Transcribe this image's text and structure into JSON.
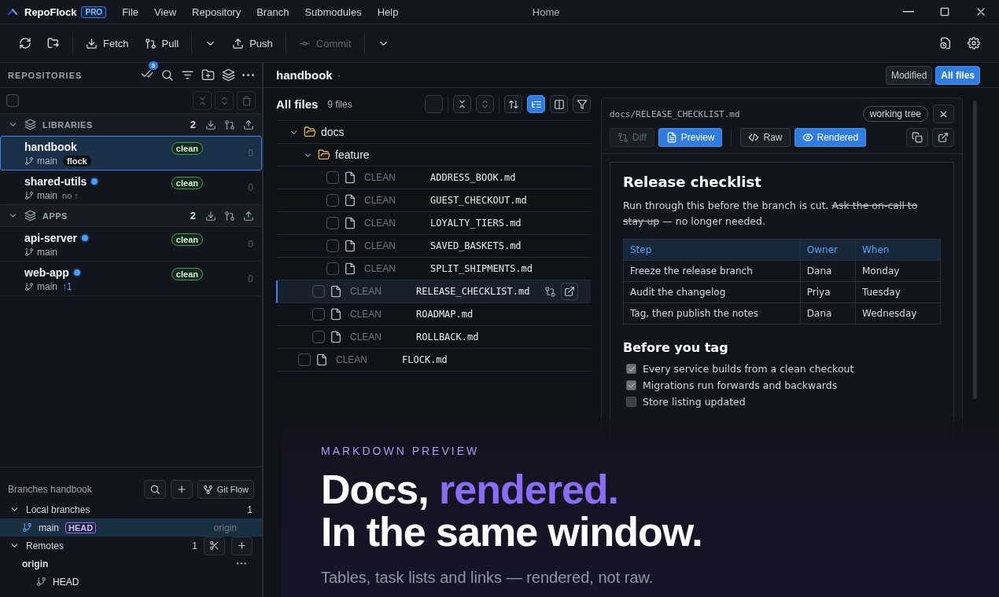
{
  "app": {
    "name": "RepoFlock",
    "badge": "PRO"
  },
  "menu": [
    "File",
    "View",
    "Repository",
    "Branch",
    "Submodules",
    "Help"
  ],
  "window": {
    "title": "Home"
  },
  "toolbar": {
    "fetch": "Fetch",
    "pull": "Pull",
    "push": "Push",
    "commit": {
      "label": "Commit",
      "disabled": true
    }
  },
  "repositories": {
    "title": "REPOSITORIES",
    "notification_count": "3",
    "select_all": {
      "checked": false
    },
    "groups": [
      {
        "name": "LIBRARIES",
        "count": "2",
        "expanded": true,
        "repos": [
          {
            "name": "handbook",
            "indicator": false,
            "branch": "main",
            "tag": "flock",
            "status": "clean",
            "changes": "0",
            "selected": true
          },
          {
            "name": "shared-utils",
            "indicator": true,
            "branch": "main",
            "sync": {
              "text": "no ↑",
              "ahead": false
            },
            "status": "clean",
            "changes": "0",
            "selected": false
          }
        ]
      },
      {
        "name": "APPS",
        "count": "2",
        "expanded": true,
        "repos": [
          {
            "name": "api-server",
            "indicator": true,
            "branch": "main",
            "status": "clean",
            "changes": "0",
            "selected": false
          },
          {
            "name": "web-app",
            "indicator": true,
            "branch": "main",
            "sync": {
              "text": "↑1",
              "ahead": true
            },
            "status": "clean",
            "changes": "0",
            "selected": false
          }
        ]
      }
    ]
  },
  "branches": {
    "title": "Branches handbook",
    "gitflow": "Git Flow",
    "local": {
      "label": "Local branches",
      "count": "1",
      "expanded": true,
      "items": [
        {
          "name": "main",
          "badge": "HEAD",
          "upstream": "origin",
          "selected": true
        }
      ]
    },
    "remotes": {
      "label": "Remotes",
      "count": "1",
      "expanded": true,
      "items": [
        {
          "name": "origin",
          "children": [
            {
              "name": "HEAD"
            }
          ]
        }
      ]
    }
  },
  "workspace": {
    "repo": "handbook",
    "separator": "·",
    "filters": [
      {
        "label": "Modified",
        "selected": false
      },
      {
        "label": "All files",
        "selected": true
      }
    ]
  },
  "files": {
    "title": "All files",
    "count": "9 files",
    "select_all": {
      "checked": false
    },
    "view_buttons": [
      {
        "selected": false
      },
      {
        "selected": true
      },
      {
        "selected": false
      },
      {
        "selected": false
      }
    ],
    "tree": [
      {
        "kind": "folder",
        "name": "docs",
        "expanded": true,
        "children": [
          {
            "kind": "folder",
            "name": "feature",
            "expanded": true,
            "children": [
              {
                "kind": "file",
                "status": "CLEAN",
                "name": "ADDRESS_BOOK.md",
                "checked": false,
                "selected": false
              },
              {
                "kind": "file",
                "status": "CLEAN",
                "name": "GUEST_CHECKOUT.md",
                "checked": false,
                "selected": false
              },
              {
                "kind": "file",
                "status": "CLEAN",
                "name": "LOYALTY_TIERS.md",
                "checked": false,
                "selected": false
              },
              {
                "kind": "file",
                "status": "CLEAN",
                "name": "SAVED_BASKETS.md",
                "checked": false,
                "selected": false
              },
              {
                "kind": "file",
                "status": "CLEAN",
                "name": "SPLIT_SHIPMENTS.md",
                "checked": false,
                "selected": false
              }
            ]
          },
          {
            "kind": "file",
            "status": "CLEAN",
            "name": "RELEASE_CHECKLIST.md",
            "checked": false,
            "selected": true
          },
          {
            "kind": "file",
            "status": "CLEAN",
            "name": "ROADMAP.md",
            "checked": false,
            "selected": false
          },
          {
            "kind": "file",
            "status": "CLEAN",
            "name": "ROLLBACK.md",
            "checked": false,
            "selected": false
          }
        ]
      },
      {
        "kind": "file",
        "status": "CLEAN",
        "name": "FLOCK.md",
        "checked": false,
        "selected": false
      }
    ]
  },
  "preview": {
    "path": "docs/RELEASE_CHECKLIST.md",
    "ref": "working tree",
    "modes": [
      {
        "label": "Diff",
        "selected": false,
        "disabled": true
      },
      {
        "label": "Preview",
        "selected": true,
        "disabled": false
      }
    ],
    "formats": [
      {
        "label": "Raw",
        "selected": false
      },
      {
        "label": "Rendered",
        "selected": true
      }
    ],
    "doc": {
      "title": "Release checklist",
      "intro": "Run through this before the branch is cut.",
      "struck": "Ask the on-call to stay up",
      "intro_end": "— no longer needed.",
      "table": {
        "columns": [
          "Step",
          "Owner",
          "When"
        ],
        "rows": [
          [
            "Freeze the release branch",
            "Dana",
            "Monday"
          ],
          [
            "Audit the changelog",
            "Priya",
            "Tuesday"
          ],
          [
            "Tag, then publish the notes",
            "Dana",
            "Wednesday"
          ]
        ]
      },
      "section": "Before you tag",
      "tasks": [
        {
          "label": "Every service builds from a clean checkout",
          "checked": true
        },
        {
          "label": "Migrations run forwards and backwards",
          "checked": true
        },
        {
          "label": "Store listing updated",
          "checked": false
        }
      ]
    }
  },
  "promo": {
    "eyebrow": "MARKDOWN PREVIEW",
    "headline": [
      {
        "text": "Docs, ",
        "accent": false
      },
      {
        "text": "rendered.",
        "accent": true
      }
    ],
    "headline_2": "In the same window.",
    "subtitle": "Tables, task lists and links — rendered, not raw."
  }
}
